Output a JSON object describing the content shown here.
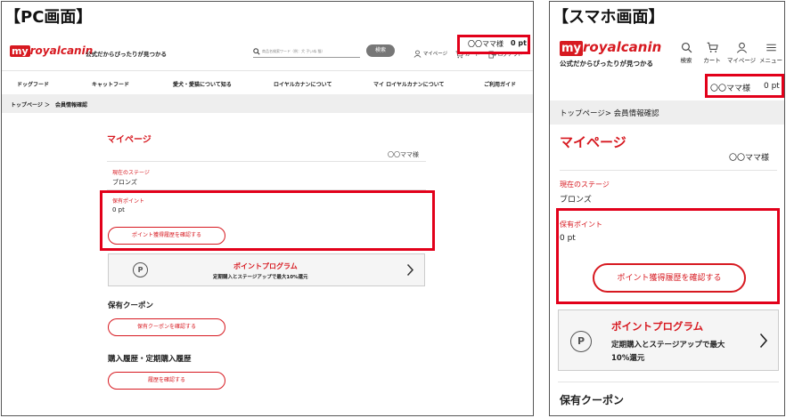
{
  "pc": {
    "frame_title": "【PC画面】",
    "logo_my": "my",
    "logo_brand": "royalcanin",
    "tagline": "公式だからぴったりが見つかる",
    "search_placeholder": "商品名検索ワード（例：犬 子いぬ 猫）",
    "search_button": "検索",
    "header_links": {
      "mypage": "マイページ",
      "cart": "カート",
      "logout": "ログアウト"
    },
    "user_badge": {
      "name": "〇〇ママ様",
      "points": "0 pt"
    },
    "nav": [
      "ドッグフード",
      "キャットフード",
      "愛犬・愛猫について知る",
      "ロイヤルカナンについて",
      "マイ ロイヤルカナンについて",
      "ご利用ガイド"
    ],
    "breadcrumb": "トップページ ＞　会員情報確認",
    "page_title": "マイページ",
    "user_name": "〇〇ママ様",
    "stage_label": "現在のステージ",
    "stage_value": "ブロンズ",
    "points_label": "保有ポイント",
    "points_value": "0 pt",
    "points_history_button": "ポイント獲得履歴を確認する",
    "program_icon": "P",
    "program_title": "ポイントプログラム",
    "program_desc": "定期購入とステージアップで最大10%還元",
    "coupon_heading": "保有クーポン",
    "coupon_button": "保有クーポンを確認する",
    "history_heading": "購入履歴・定期購入履歴",
    "history_button": "履歴を確認する"
  },
  "sp": {
    "frame_title": "【スマホ画面】",
    "logo_my": "my",
    "logo_brand": "royalcanin",
    "tagline": "公式だからぴったりが見つかる",
    "header_links": {
      "search": "検索",
      "cart": "カート",
      "mypage": "マイページ",
      "menu": "メニュー"
    },
    "user_badge": {
      "name": "〇〇ママ様",
      "points": "0 pt"
    },
    "breadcrumb": "トップページ> 会員情報確認",
    "page_title": "マイページ",
    "user_name": "〇〇ママ様",
    "stage_label": "現在のステージ",
    "stage_value": "ブロンズ",
    "points_label": "保有ポイント",
    "points_value": "0 pt",
    "points_history_button": "ポイント獲得履歴を確認する",
    "program_icon": "P",
    "program_title": "ポイントプログラム",
    "program_desc_1": "定期購入とステージアップで最大",
    "program_desc_2": "10%還元",
    "coupon_heading": "保有クーポン"
  },
  "colors": {
    "brand_red": "#d71920",
    "highlight_red": "#e2001a",
    "breadcrumb_bg": "#eeeeee"
  }
}
